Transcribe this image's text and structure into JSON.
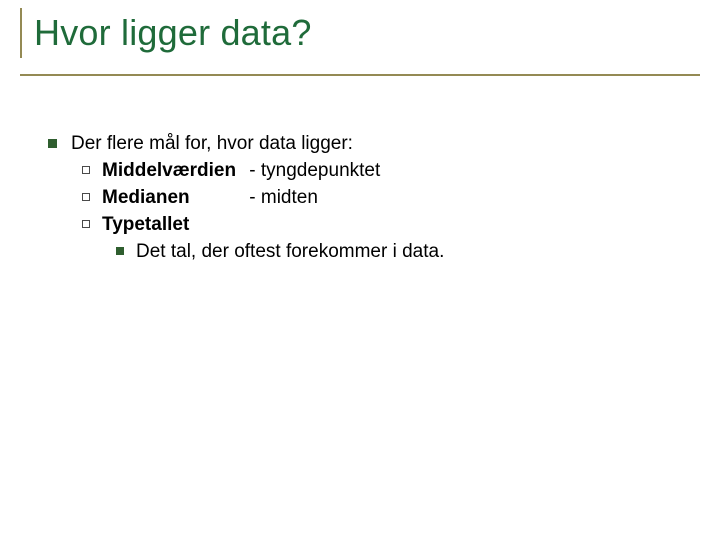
{
  "title": "Hvor ligger data?",
  "intro": "Der flere mål for, hvor data ligger:",
  "items": [
    {
      "term": "Middelværdien",
      "desc": "- tyngdepunktet"
    },
    {
      "term": "Medianen",
      "desc": "- midten"
    },
    {
      "term": "Typetallet",
      "sub": "Det tal, der oftest forekommer i data."
    }
  ]
}
